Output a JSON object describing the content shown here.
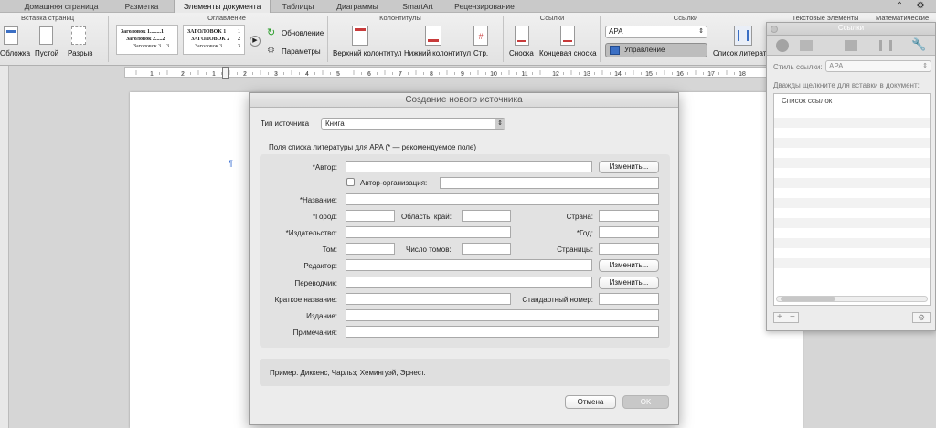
{
  "ribbon_tabs": [
    "Домашняя страница",
    "Разметка",
    "Элементы документа",
    "Таблицы",
    "Диаграммы",
    "SmartArt",
    "Рецензирование"
  ],
  "ribbon_groups": {
    "page_insert": "Вставка страниц",
    "toc": "Оглавление",
    "headers": "Колонтитулы",
    "footnotes": "Ссылки",
    "citations": "Ссылки",
    "text": "Текстовые элементы",
    "math": "Математические"
  },
  "ribbon_items": {
    "cover": "Обложка",
    "blank": "Пустой",
    "break": "Разрыв",
    "toc_sample1": [
      "Заголовок 1........1",
      "Заголовок 2.....2",
      "Заголовок 3....3"
    ],
    "toc_sample2": [
      "ЗАГОЛОВОК 1",
      "ЗАГОЛОВОК 2",
      "Заголовок 3"
    ],
    "toc_sample2_nums": [
      "1",
      "2",
      "3"
    ],
    "update": "Обновление",
    "params": "Параметры",
    "header": "Верхний колонтитул",
    "footer": "Нижний колонтитул",
    "page_num": "Стр.",
    "footnote": "Сноска",
    "endnote": "Концевая сноска",
    "style_value": "APA",
    "manage": "Управление",
    "bibliography": "Список литерат"
  },
  "dialog": {
    "title": "Создание нового источника",
    "source_type_label": "Тип источника",
    "source_type_value": "Книга",
    "fields_heading": "Поля списка литературы для APA  (* — рекомендуемое поле)",
    "author": "Автор:",
    "edit": "Изменить...",
    "corp_author": "Автор-организация:",
    "title_field": "Название:",
    "city": "Город:",
    "region": "Область, край:",
    "country": "Страна:",
    "publisher": "Издательство:",
    "year": "Год:",
    "volume": "Том:",
    "num_volumes": "Число томов:",
    "pages": "Страницы:",
    "editor": "Редактор:",
    "translator": "Переводчик:",
    "short_title": "Краткое название:",
    "standard_number": "Стандартный номер:",
    "edition": "Издание:",
    "notes": "Примечания:",
    "example": "Пример. Диккенс, Чарльз; Хемингуэй, Эрнест.",
    "cancel": "Отмена",
    "ok": "OK"
  },
  "panel": {
    "title": "Ссылки",
    "style_label": "Стиль ссылки:",
    "style_value": "APA",
    "hint": "Дважды щелкните для вставки в документ:",
    "list_header": "Список ссылок"
  },
  "ruler_numbers": [
    "1",
    "2",
    "1",
    "2",
    "3",
    "4",
    "5",
    "6",
    "7",
    "8",
    "9",
    "10",
    "11",
    "12",
    "13",
    "14",
    "15",
    "16",
    "17",
    "18"
  ]
}
